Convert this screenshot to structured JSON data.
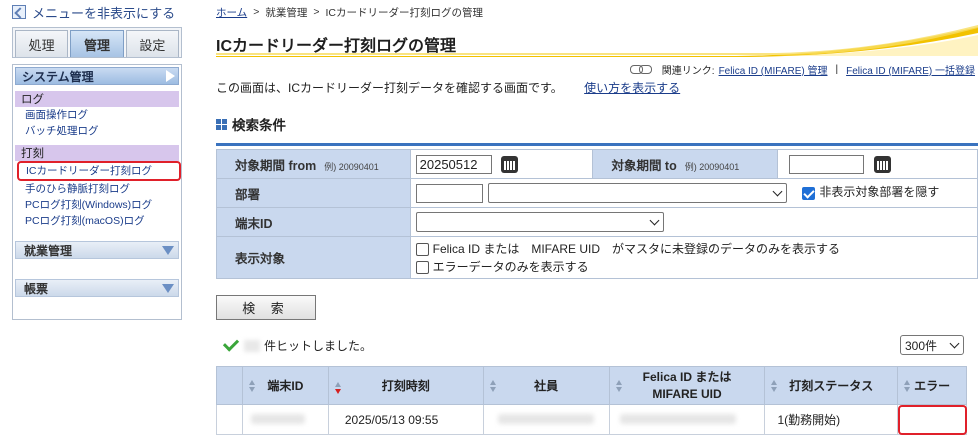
{
  "sidebar": {
    "hide_menu_label": "メニューを非表示にする",
    "tabs": [
      {
        "label": "処理",
        "active": false
      },
      {
        "label": "管理",
        "active": true
      },
      {
        "label": "設定",
        "active": false
      }
    ],
    "system_header": "システム管理",
    "categories": [
      {
        "label": "ログ",
        "links": [
          "画面操作ログ",
          "バッチ処理ログ"
        ]
      },
      {
        "label": "打刻",
        "links": [
          "ICカードリーダー打刻ログ",
          "手のひら静脈打刻ログ",
          "PCログ打刻(Windows)ログ",
          "PCログ打刻(macOS)ログ"
        ]
      }
    ],
    "current_link": "ICカードリーダー打刻ログ",
    "collapsed_sections": [
      "就業管理",
      "帳票"
    ]
  },
  "breadcrumb": [
    "ホーム",
    "就業管理",
    "ICカードリーダー打刻ログの管理"
  ],
  "page_title": "ICカードリーダー打刻ログの管理",
  "related": {
    "label": "関連リンク:",
    "links": [
      "Felica ID (MIFARE) 管理",
      "Felica ID (MIFARE) 一括登録"
    ],
    "separator": "|"
  },
  "description": "この画面は、ICカードリーダー打刻データを確認する画面です。",
  "howto_link": "使い方を表示する",
  "search_section_title": "検索条件",
  "conditions": {
    "period_from_label": "対象期間 from",
    "period_from_hint": "例) 20090401",
    "period_from_value": "20250512",
    "period_to_label": "対象期間 to",
    "period_to_hint": "例) 20090401",
    "period_to_value": "",
    "dept_label": "部署",
    "dept_code_value": "",
    "dept_select_value": "",
    "hide_depts_label": "非表示対象部署を隠す",
    "hide_depts_checked": true,
    "terminal_label": "端末ID",
    "terminal_value": "",
    "display_label": "表示対象",
    "unregistered_only_label": "Felica ID または　MIFARE UID　がマスタに未登録のデータのみを表示する",
    "error_only_label": "エラーデータのみを表示する"
  },
  "search_button": "検 索",
  "result_message": "件ヒットしました。",
  "per_page": "300件",
  "results": {
    "headers": [
      "端末ID",
      "打刻時刻",
      "社員",
      "Felica ID または\nMIFARE UID",
      "打刻ステータス",
      "エラー"
    ],
    "rows": [
      {
        "terminal": "",
        "time": "2025/05/13 09:55",
        "employee": "",
        "uid": "",
        "status": "1(勤務開始)",
        "error": ""
      }
    ]
  },
  "colors": {
    "accent": "#3a73bf",
    "header_bg": "#c9d8ee",
    "highlight": "#e0202a",
    "category_bg": "#d7c6ec"
  }
}
